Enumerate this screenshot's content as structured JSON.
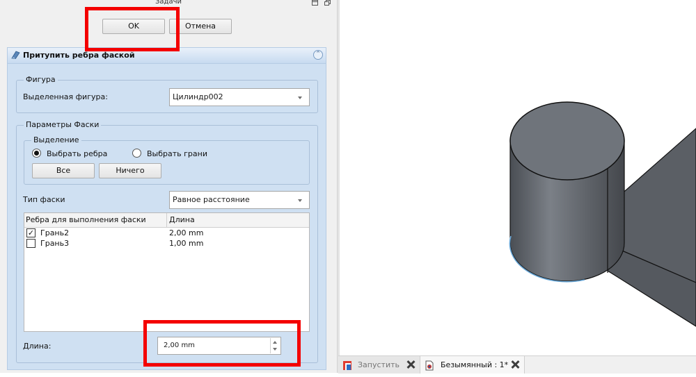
{
  "dock": {
    "title": "Задачи",
    "float_icon": "float-icon",
    "close_icon": "dock-close-icon"
  },
  "buttons": {
    "ok": "OK",
    "cancel": "Отмена"
  },
  "task": {
    "title": "Притупить ребра фаской",
    "icon": "chamfer-icon",
    "shape_group": {
      "title": "Фигура",
      "selected_label": "Выделенная фигура:",
      "selected_value": "Цилиндр002"
    },
    "params_group": {
      "title": "Параметры Фаски",
      "selection_group": {
        "title": "Выделение",
        "radio_edges": "Выбрать ребра",
        "radio_faces": "Выбрать грани",
        "selected_radio": "Выбрать ребра",
        "all_btn": "Все",
        "none_btn": "Ничего"
      },
      "type_label": "Тип фаски",
      "type_value": "Равное расстояние",
      "table": {
        "headers": [
          "Ребра для выполнения фаски",
          "Длина"
        ],
        "rows": [
          {
            "name": "Грань2",
            "length": "2,00 mm",
            "checked": true
          },
          {
            "name": "Грань3",
            "length": "1,00 mm",
            "checked": false
          }
        ]
      },
      "length_label": "Длина:",
      "length_value": "2,00 mm"
    }
  },
  "tabs": [
    {
      "label": "Запустить",
      "icon": "freecad-start-icon",
      "active": false
    },
    {
      "label": "Безымянный : 1*",
      "icon": "document-icon",
      "active": true
    }
  ],
  "colors": {
    "highlight": "#f40000",
    "task_bg": "#cfe0f2",
    "model_top": "#6f747b",
    "model_side": "#4f5359"
  }
}
